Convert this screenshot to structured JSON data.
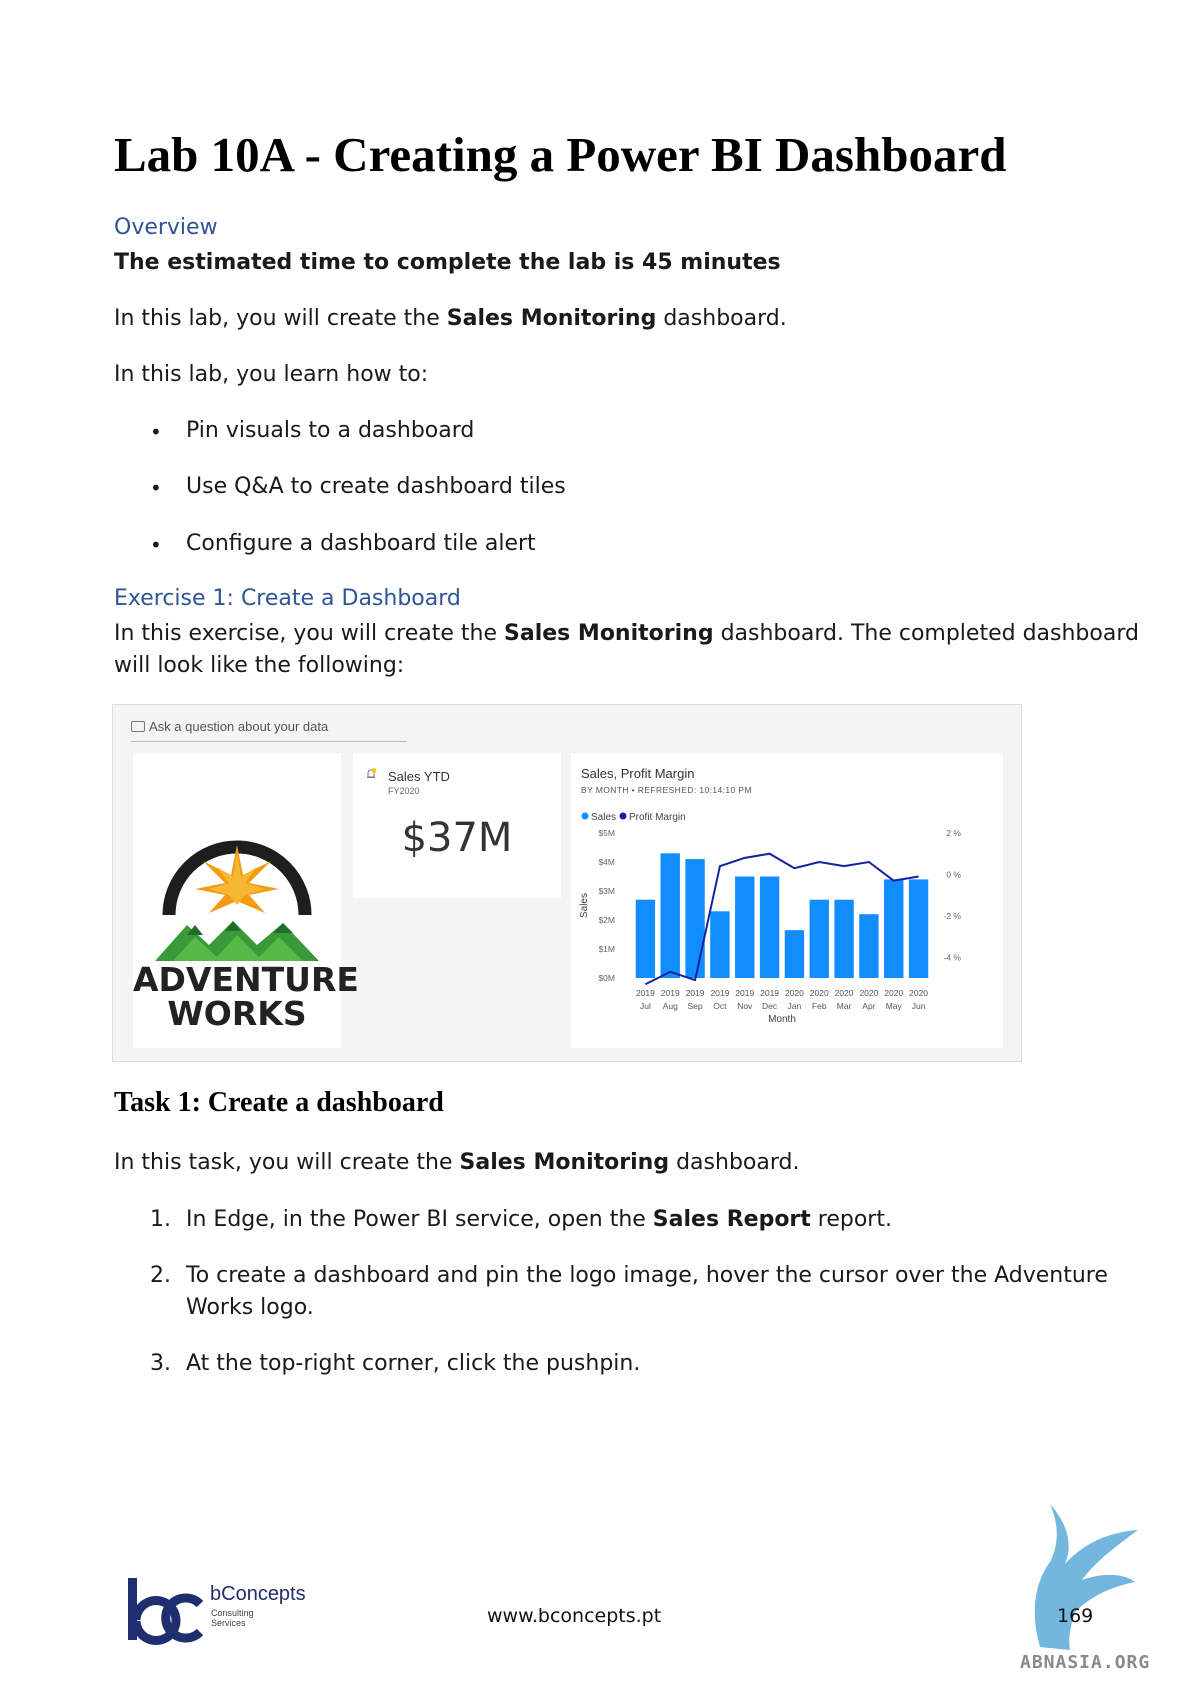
{
  "document": {
    "title": "Lab 10A - Creating a Power BI Dashboard",
    "overview_heading": "Overview",
    "estimated_time": "The estimated time to complete the lab is 45 minutes",
    "intro": {
      "before": "In this lab, you will create the ",
      "bold": "Sales Monitoring",
      "after": " dashboard."
    },
    "learn_intro": "In this lab, you learn how to:",
    "learn_items": [
      "Pin visuals to a dashboard",
      "Use Q&A to create dashboard tiles",
      "Configure a dashboard tile alert"
    ],
    "exercise_heading": "Exercise 1: Create a Dashboard",
    "exercise_text": {
      "before": "In this exercise, you will create the ",
      "bold": "Sales Monitoring",
      "after": " dashboard. The completed dashboard",
      "line2": "will look like the following:"
    },
    "task_heading": "Task 1: Create a dashboard",
    "task_intro": {
      "before": "In this task, you will create the ",
      "bold": "Sales Monitoring",
      "after": " dashboard."
    },
    "steps": [
      {
        "num": "1.",
        "before": "In Edge, in the Power BI service, open the ",
        "bold": "Sales Report",
        "after": " report."
      },
      {
        "num": "2.",
        "line1": "To create a dashboard and pin the logo image, hover the cursor over the Adventure",
        "line2": "Works logo."
      },
      {
        "num": "3.",
        "text": "At the top-right corner, click the pushpin."
      }
    ]
  },
  "dashboard": {
    "qa_placeholder": "Ask a question about your data",
    "logo_line1": "ADVENTURE",
    "logo_line2": "WORKS",
    "kpi": {
      "title": "Sales YTD",
      "subtitle": "FY2020",
      "value": "$37M",
      "alert_badge": "1"
    },
    "chart_tile": {
      "title": "Sales, Profit Margin",
      "subtitle": "BY MONTH  •  REFRESHED: 10:14:10 PM"
    }
  },
  "chart_data": {
    "type": "bar",
    "title": "Sales, Profit Margin",
    "xlabel": "Month",
    "ylabel": "Sales",
    "legend": [
      "Sales",
      "Profit Margin"
    ],
    "legend_position": "top-left",
    "categories": [
      {
        "year": "2019",
        "month": "Jul"
      },
      {
        "year": "2019",
        "month": "Aug"
      },
      {
        "year": "2019",
        "month": "Sep"
      },
      {
        "year": "2019",
        "month": "Oct"
      },
      {
        "year": "2019",
        "month": "Nov"
      },
      {
        "year": "2019",
        "month": "Dec"
      },
      {
        "year": "2020",
        "month": "Jan"
      },
      {
        "year": "2020",
        "month": "Feb"
      },
      {
        "year": "2020",
        "month": "Mar"
      },
      {
        "year": "2020",
        "month": "Apr"
      },
      {
        "year": "2020",
        "month": "May"
      },
      {
        "year": "2020",
        "month": "Jun"
      }
    ],
    "y_ticks": [
      "$0M",
      "$1M",
      "$2M",
      "$3M",
      "$4M",
      "$5M"
    ],
    "y2_ticks": [
      "-4 %",
      "-2 %",
      "0 %",
      "2 %"
    ],
    "ylim": [
      0,
      5
    ],
    "y2lim": [
      -5,
      2
    ],
    "series": [
      {
        "name": "Sales",
        "axis": "left",
        "color": "#118dff",
        "values": [
          2.7,
          4.3,
          4.1,
          2.3,
          3.5,
          3.5,
          1.65,
          2.7,
          2.7,
          2.2,
          3.4,
          3.4
        ]
      },
      {
        "name": "Profit Margin",
        "axis": "right",
        "color": "#12239e",
        "values": [
          -5.3,
          -4.7,
          -5.1,
          0.4,
          0.8,
          1.0,
          0.3,
          0.6,
          0.4,
          0.6,
          -0.3,
          -0.1
        ]
      }
    ]
  },
  "footer": {
    "brand_name": "bConcepts",
    "brand_sub_line1": "Consulting",
    "brand_sub_line2": "Services",
    "url": "www.bconcepts.pt",
    "page_number": "169",
    "watermark": "ABNASIA.ORG"
  },
  "colors": {
    "heading_blue": "#2e5496",
    "bar_blue": "#118dff",
    "line_navy": "#12239e"
  }
}
